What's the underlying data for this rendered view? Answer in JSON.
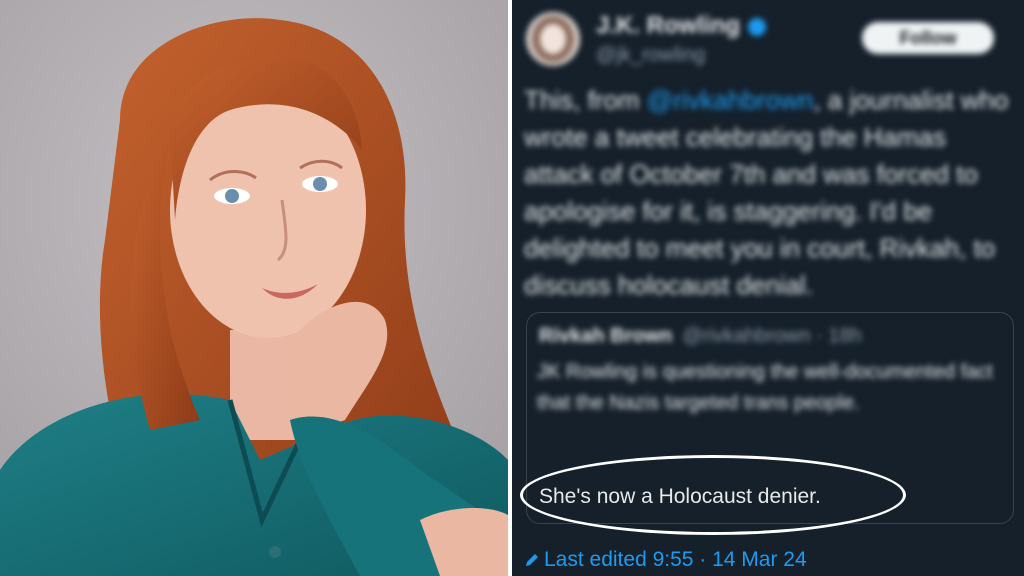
{
  "tweet": {
    "author_name": "J.K. Rowling",
    "author_handle": "@jk_rowling",
    "follow_label": "Follow",
    "text_pre": "This, from ",
    "mention": "@rivkahbrown",
    "text_post": ", a journalist who wrote a tweet celebrating the Hamas attack of October 7th and was forced to apologise for it, is staggering. I'd be delighted to meet you in court, Rivkah, to discuss holocaust denial.",
    "quote": {
      "author_name": "Rivkah Brown",
      "author_handle": "@rivkahbrown · 18h",
      "text": "JK Rowling is questioning the well-documented fact that the Nazis targeted trans people.",
      "highlight": "She's now a Holocaust denier."
    },
    "edited_label": "Last edited 9:55 · 14 Mar 24"
  },
  "colors": {
    "tweet_bg": "#15202b",
    "accent": "#1d9bf0",
    "annotation": "#ffffff"
  }
}
